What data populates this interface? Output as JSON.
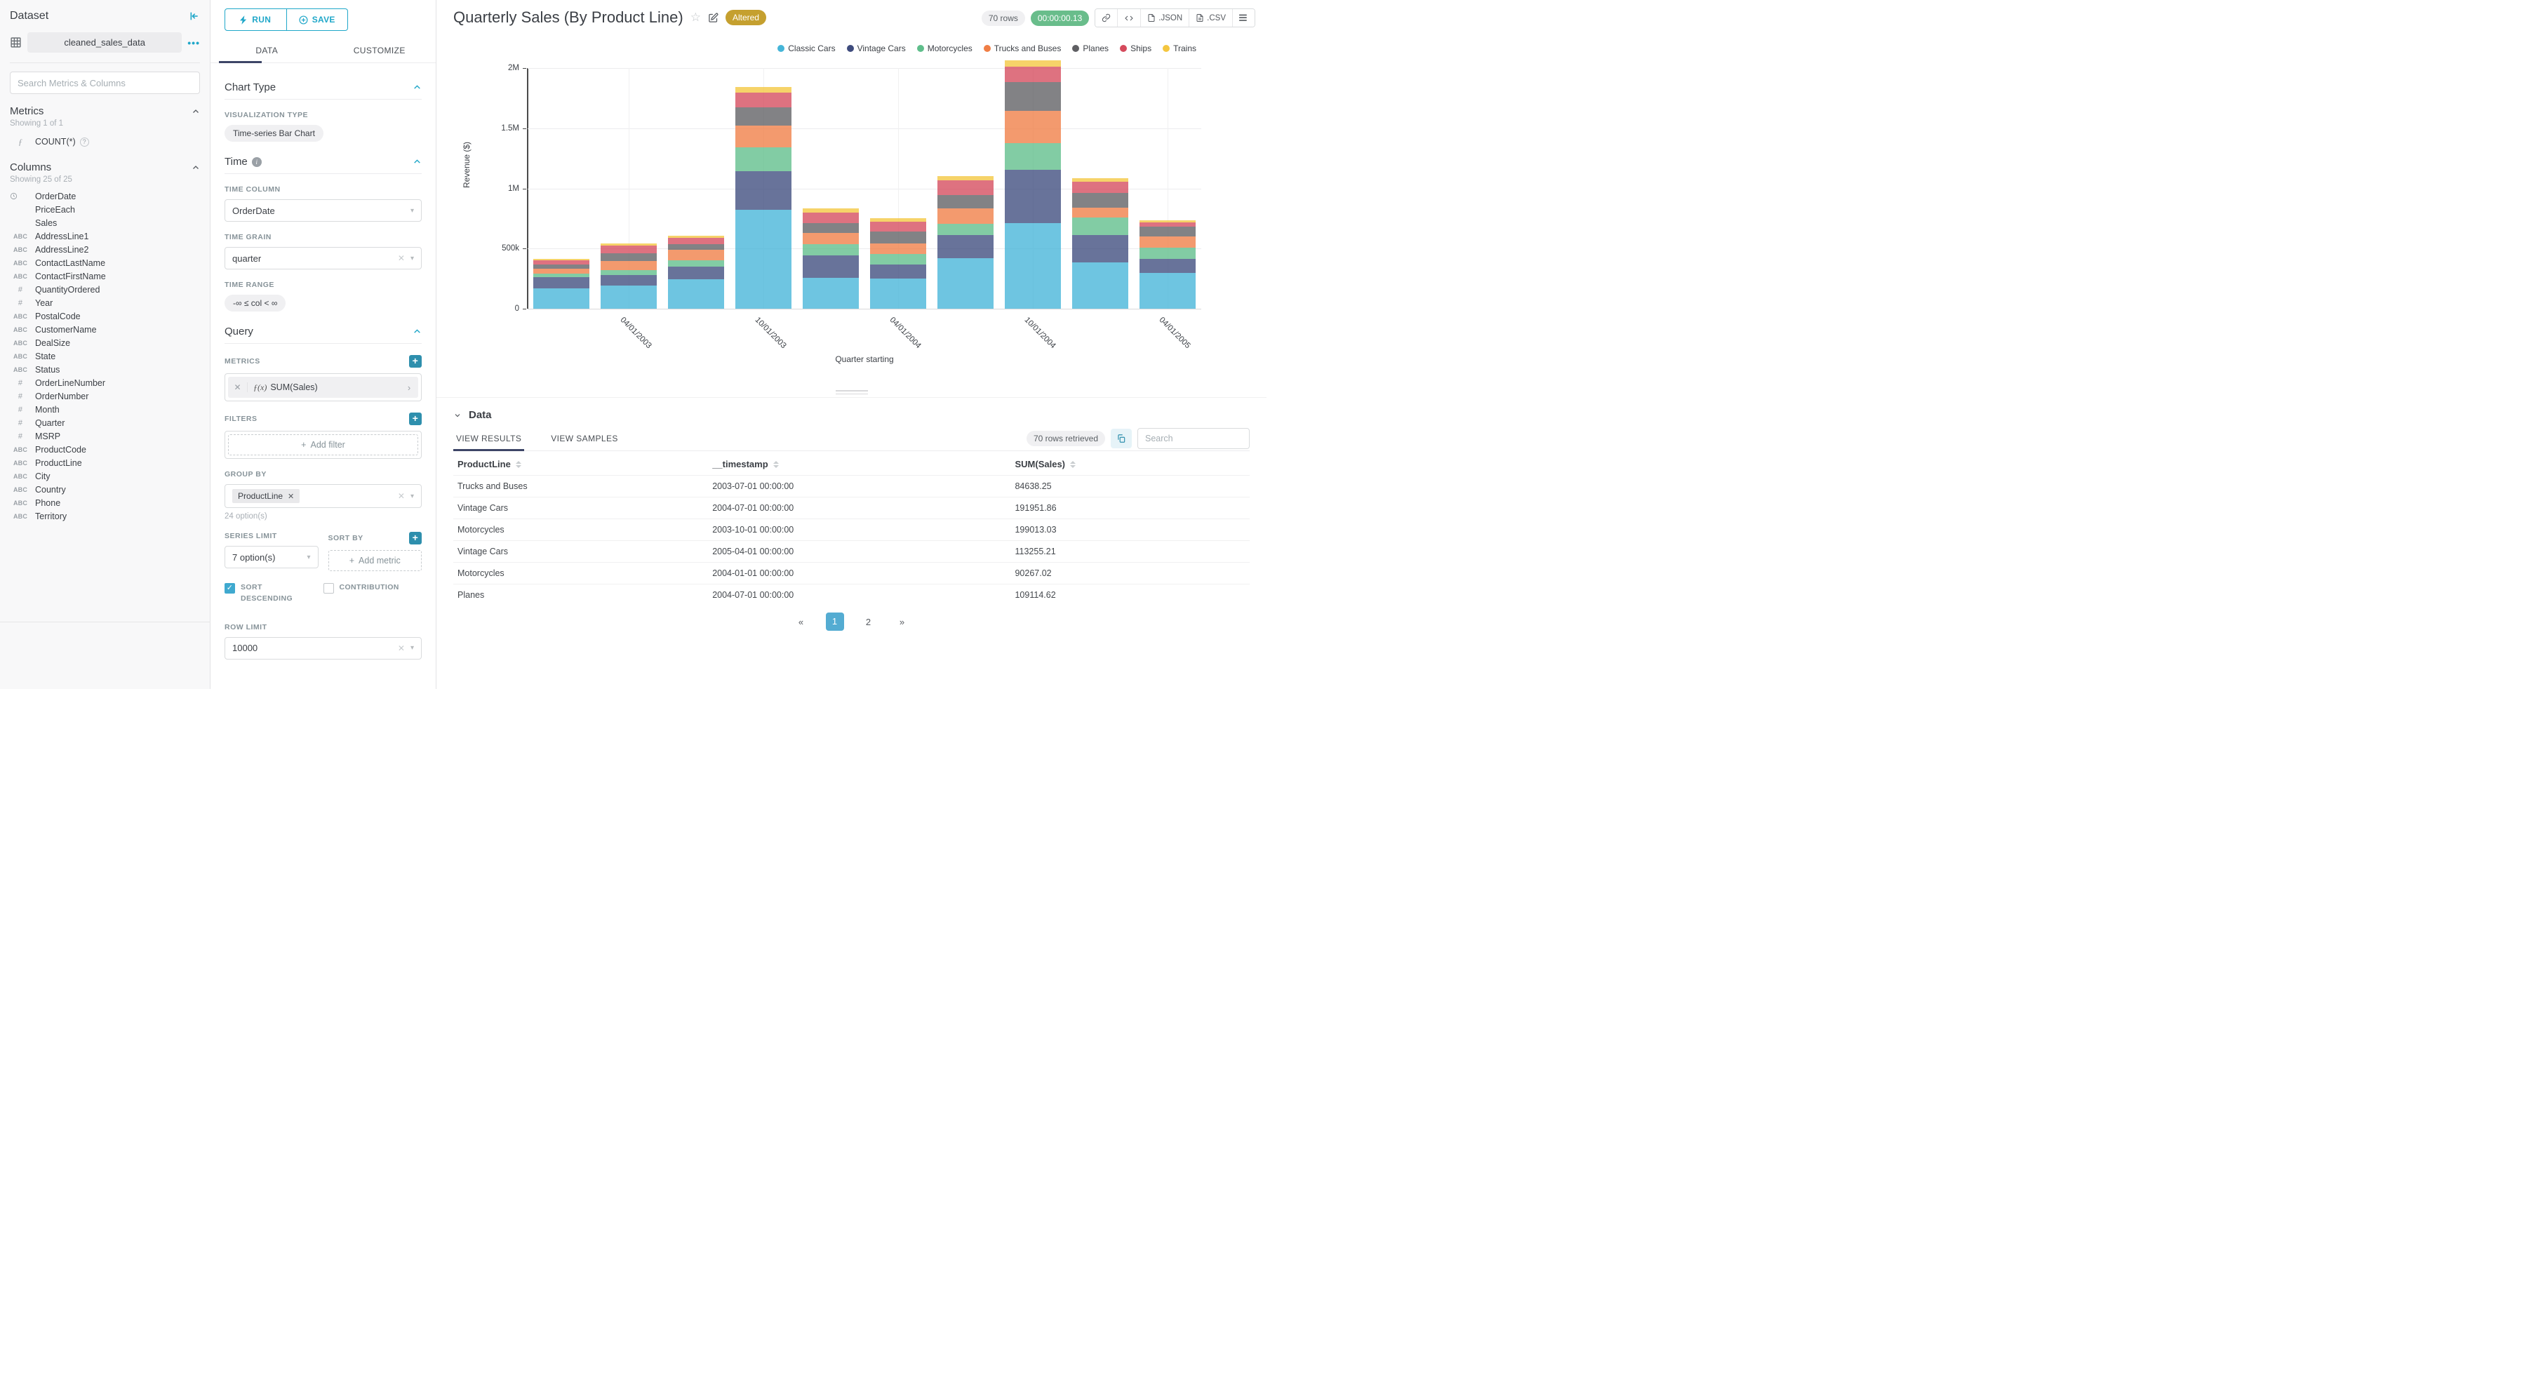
{
  "dataset_panel": {
    "title": "Dataset",
    "dataset_name": "cleaned_sales_data",
    "search_placeholder": "Search Metrics & Columns",
    "metrics_header": "Metrics",
    "metrics_showing": "Showing 1 of 1",
    "metrics": [
      {
        "icon": "function",
        "name": "COUNT(*)"
      }
    ],
    "columns_header": "Columns",
    "columns_showing": "Showing 25 of 25",
    "type_glyphs": {
      "str": "ABC",
      "num": "#",
      "time": "clock",
      "none": ""
    },
    "columns": [
      {
        "type": "time",
        "name": "OrderDate"
      },
      {
        "type": "none",
        "name": "PriceEach"
      },
      {
        "type": "none",
        "name": "Sales"
      },
      {
        "type": "str",
        "name": "AddressLine1"
      },
      {
        "type": "str",
        "name": "AddressLine2"
      },
      {
        "type": "str",
        "name": "ContactLastName"
      },
      {
        "type": "str",
        "name": "ContactFirstName"
      },
      {
        "type": "num",
        "name": "QuantityOrdered"
      },
      {
        "type": "num",
        "name": "Year"
      },
      {
        "type": "str",
        "name": "PostalCode"
      },
      {
        "type": "str",
        "name": "CustomerName"
      },
      {
        "type": "str",
        "name": "DealSize"
      },
      {
        "type": "str",
        "name": "State"
      },
      {
        "type": "str",
        "name": "Status"
      },
      {
        "type": "num",
        "name": "OrderLineNumber"
      },
      {
        "type": "num",
        "name": "OrderNumber"
      },
      {
        "type": "num",
        "name": "Month"
      },
      {
        "type": "num",
        "name": "Quarter"
      },
      {
        "type": "num",
        "name": "MSRP"
      },
      {
        "type": "str",
        "name": "ProductCode"
      },
      {
        "type": "str",
        "name": "ProductLine"
      },
      {
        "type": "str",
        "name": "City"
      },
      {
        "type": "str",
        "name": "Country"
      },
      {
        "type": "str",
        "name": "Phone"
      },
      {
        "type": "str",
        "name": "Territory"
      }
    ]
  },
  "control_panel": {
    "run_label": "RUN",
    "save_label": "SAVE",
    "tab_data": "DATA",
    "tab_customize": "CUSTOMIZE",
    "chart_type_header": "Chart Type",
    "viz_type_label": "VISUALIZATION TYPE",
    "viz_type_value": "Time-series Bar Chart",
    "time_header": "Time",
    "time_column_label": "TIME COLUMN",
    "time_column_value": "OrderDate",
    "time_grain_label": "TIME GRAIN",
    "time_grain_value": "quarter",
    "time_range_label": "TIME RANGE",
    "time_range_value": "-∞ ≤ col < ∞",
    "query_header": "Query",
    "metrics_label": "METRICS",
    "metric_fx": "ƒ(x)",
    "metric_value": "SUM(Sales)",
    "filters_label": "FILTERS",
    "add_filter_label": "Add filter",
    "group_by_label": "GROUP BY",
    "group_by_value": "ProductLine",
    "group_by_options": "24 option(s)",
    "series_limit_label": "SERIES LIMIT",
    "series_limit_value": "7 option(s)",
    "sort_by_label": "SORT BY",
    "add_metric_label": "Add metric",
    "sort_descending_label": "SORT DESCENDING",
    "contribution_label": "CONTRIBUTION",
    "row_limit_label": "ROW LIMIT",
    "row_limit_value": "10000"
  },
  "chart_header": {
    "title": "Quarterly Sales (By Product Line)",
    "altered_badge": "Altered",
    "rows_badge": "70 rows",
    "duration_badge": "00:00:00.13",
    "export_json_label": ".JSON",
    "export_csv_label": ".CSV"
  },
  "chart_data": {
    "type": "bar",
    "stacked": true,
    "title": "Quarterly Sales (By Product Line)",
    "xlabel": "Quarter starting",
    "ylabel": "Revenue ($)",
    "ylim": [
      0,
      2000000
    ],
    "ytick_labels": [
      "0",
      "500k",
      "1M",
      "1.5M",
      "2M"
    ],
    "grid": true,
    "legend_position": "top-right",
    "x": [
      "2003-01-01",
      "2003-04-01",
      "2003-07-01",
      "2003-10-01",
      "2004-01-01",
      "2004-04-01",
      "2004-07-01",
      "2004-10-01",
      "2005-01-01",
      "2005-04-01"
    ],
    "xtick_labels": [
      "04/01/2003",
      "10/01/2003",
      "04/01/2004",
      "10/01/2004",
      "04/01/2005"
    ],
    "xtick_slots": [
      1,
      3,
      5,
      7,
      9
    ],
    "series": [
      {
        "name": "Classic Cars",
        "color": "#45B5D8",
        "values": [
          170000,
          190000,
          245000,
          820000,
          255000,
          250000,
          420000,
          710000,
          385000,
          300000
        ]
      },
      {
        "name": "Vintage Cars",
        "color": "#3E4B7D",
        "values": [
          95000,
          90000,
          105000,
          325000,
          190000,
          120000,
          191951.86,
          445000,
          225000,
          113255.21
        ]
      },
      {
        "name": "Motorcycles",
        "color": "#5FBE8B",
        "values": [
          28000,
          40000,
          55000,
          199013.03,
          90267.02,
          85000,
          95000,
          219000,
          150000,
          95000
        ]
      },
      {
        "name": "Trucks and Buses",
        "color": "#F07E45",
        "values": [
          40000,
          75000,
          84638.25,
          180000,
          95000,
          90000,
          130000,
          268000,
          80000,
          95000
        ]
      },
      {
        "name": "Planes",
        "color": "#5F5F63",
        "values": [
          32000,
          65000,
          45000,
          150000,
          80000,
          95000,
          109114.62,
          240000,
          122000,
          80000
        ]
      },
      {
        "name": "Ships",
        "color": "#D54A5C",
        "values": [
          38000,
          65000,
          55000,
          120000,
          90000,
          85000,
          120000,
          130000,
          96000,
          36000
        ]
      },
      {
        "name": "Trains",
        "color": "#F4C63F",
        "values": [
          10000,
          15000,
          20000,
          50000,
          35000,
          25000,
          35000,
          50000,
          28000,
          15000
        ]
      }
    ]
  },
  "results_panel": {
    "header": "Data",
    "tab_results": "VIEW RESULTS",
    "tab_samples": "VIEW SAMPLES",
    "rows_retrieved": "70 rows retrieved",
    "search_placeholder": "Search",
    "columns": [
      "ProductLine",
      "__timestamp",
      "SUM(Sales)"
    ],
    "rows": [
      [
        "Trucks and Buses",
        "2003-07-01 00:00:00",
        "84638.25"
      ],
      [
        "Vintage Cars",
        "2004-07-01 00:00:00",
        "191951.86"
      ],
      [
        "Motorcycles",
        "2003-10-01 00:00:00",
        "199013.03"
      ],
      [
        "Vintage Cars",
        "2005-04-01 00:00:00",
        "113255.21"
      ],
      [
        "Motorcycles",
        "2004-01-01 00:00:00",
        "90267.02"
      ],
      [
        "Planes",
        "2004-07-01 00:00:00",
        "109114.62"
      ]
    ],
    "pagination": {
      "prev": "«",
      "pages": [
        "1",
        "2"
      ],
      "active": "1",
      "next": "»"
    }
  }
}
